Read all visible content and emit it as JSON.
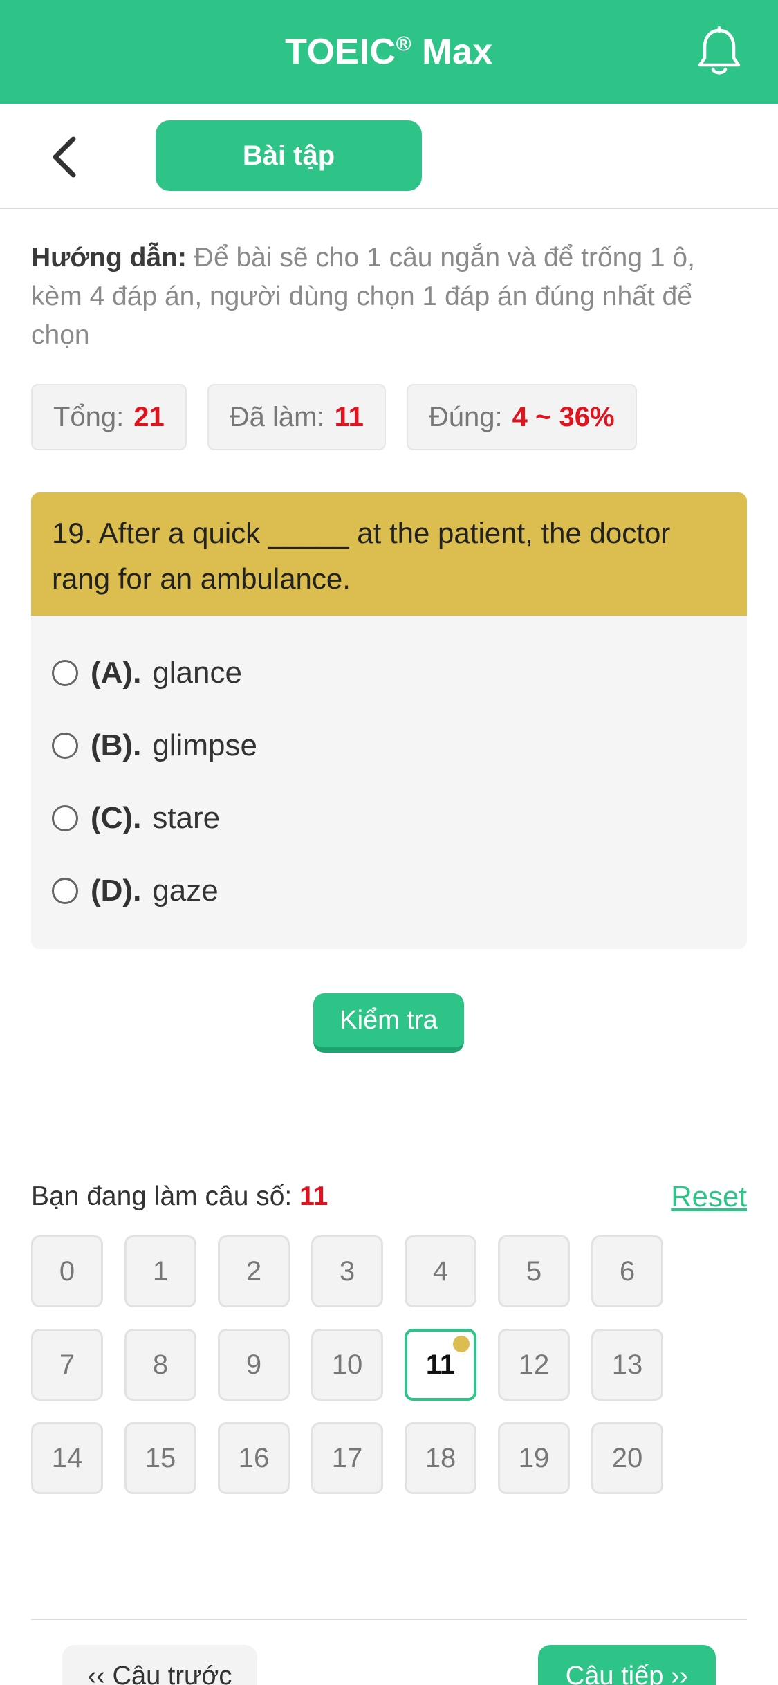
{
  "header": {
    "title": "TOEIC",
    "title_mark": "®",
    "title_suffix": " Max",
    "bell_icon": "bell-icon",
    "bg_color": "#2ec487"
  },
  "subbar": {
    "back_icon": "chevron-left-icon",
    "tab_label": "Bài tập"
  },
  "instruction": {
    "label": "Hướng dẫn:",
    "text": " Để bài sẽ cho 1 câu ngắn và để trống 1 ô, kèm 4 đáp án, người dùng chọn 1 đáp án đúng nhất để chọn"
  },
  "stats": [
    {
      "label": "Tổng:",
      "value": "21"
    },
    {
      "label": "Đã làm:",
      "value": "11"
    },
    {
      "label": "Đúng:",
      "value": "4 ~ 36%"
    }
  ],
  "question": {
    "text": "19. After a quick _____ at the patient, the doctor rang for an ambulance.",
    "header_color": "#dbbe4f",
    "options": [
      {
        "key": "(A).",
        "text": "glance"
      },
      {
        "key": "(B).",
        "text": "glimpse"
      },
      {
        "key": "(C).",
        "text": "stare"
      },
      {
        "key": "(D).",
        "text": "gaze"
      }
    ]
  },
  "check_button": "Kiểm tra",
  "progress": {
    "label": "Bạn đang làm câu số:",
    "current": "11",
    "reset_label": "Reset"
  },
  "grid": {
    "cells": [
      "0",
      "1",
      "2",
      "3",
      "4",
      "5",
      "6",
      "7",
      "8",
      "9",
      "10",
      "11",
      "12",
      "13",
      "14",
      "15",
      "16",
      "17",
      "18",
      "19",
      "20"
    ],
    "active": "11"
  },
  "nav": {
    "prev_label": "‹‹ Câu trước",
    "next_label": "Câu tiếp ››"
  }
}
